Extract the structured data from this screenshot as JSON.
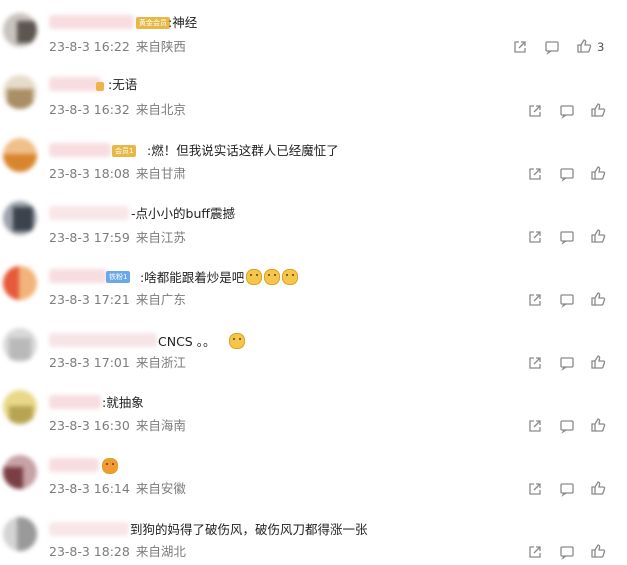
{
  "comments": [
    {
      "badge": "黄金会员",
      "badge_kind": "gold",
      "text": ":神经",
      "date": "23-8-3 16:22",
      "location": "来自陕西",
      "likes": "3"
    },
    {
      "badge": "",
      "badge_kind": "none",
      "text": ":无语",
      "date": "23-8-3 16:32",
      "location": "来自北京",
      "likes": ""
    },
    {
      "badge": "会员1",
      "badge_kind": "gold",
      "text": ":燃！但我说实话这群人已经魔怔了",
      "date": "23-8-3 18:08",
      "location": "来自甘肃",
      "likes": ""
    },
    {
      "badge": "",
      "badge_kind": "none",
      "text": "-点小小的buff震撼",
      "date": "23-8-3 17:59",
      "location": "来自江苏",
      "likes": ""
    },
    {
      "badge": "铁粉1",
      "badge_kind": "blue",
      "text": ":啥都能跟着炒是吧",
      "date": "23-8-3 17:21",
      "location": "来自广东",
      "likes": ""
    },
    {
      "badge": "",
      "badge_kind": "none",
      "text": "CNCS 。。",
      "date": "23-8-3 17:01",
      "location": "来自浙江",
      "likes": ""
    },
    {
      "badge": "",
      "badge_kind": "none",
      "text": ":就抽象",
      "date": "23-8-3 16:30",
      "location": "来自海南",
      "likes": ""
    },
    {
      "badge": "",
      "badge_kind": "none",
      "text": "",
      "date": "23-8-3 16:14",
      "location": "来自安徽",
      "likes": ""
    },
    {
      "badge": "",
      "badge_kind": "none",
      "text": "到狗的妈得了破伤风，破伤风刀都得涨一张",
      "date": "23-8-3 18:28",
      "location": "来自湖北",
      "likes": ""
    }
  ],
  "icons": {
    "share": "share-icon",
    "comment": "comment-icon",
    "like": "thumbs-up-icon"
  },
  "colors": {
    "meta_text": "#7c7c7c",
    "icon": "#8a8a8a",
    "gold_badge": "#e7b845",
    "blue_badge": "#6aa8ea"
  }
}
